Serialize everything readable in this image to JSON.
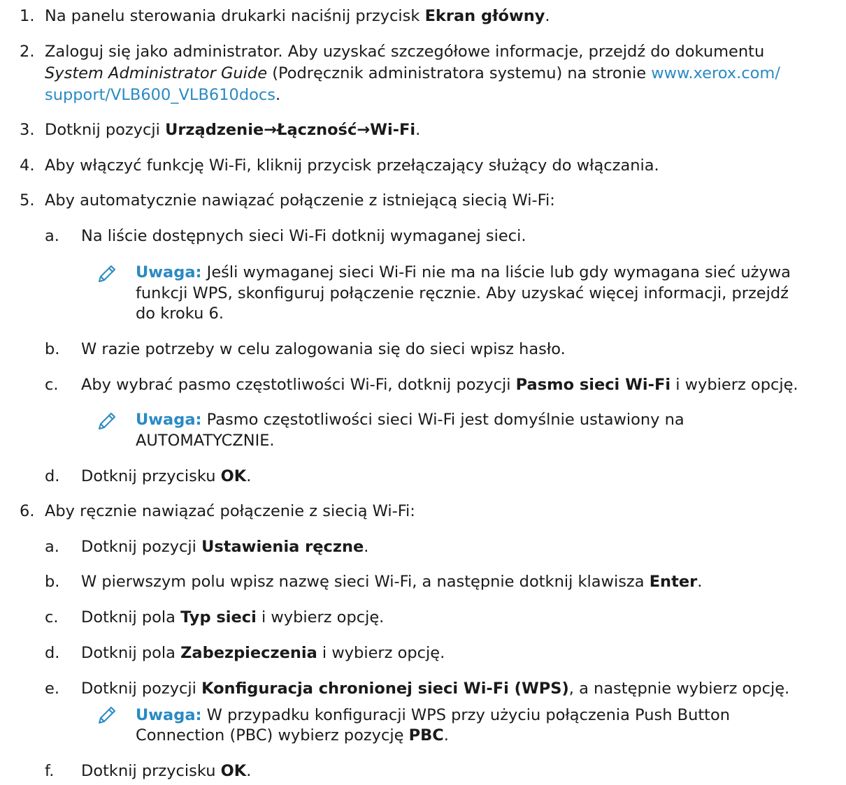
{
  "colors": {
    "text": "#1a1a1a",
    "accent": "#2a8ac4"
  },
  "steps": {
    "s1": {
      "num": "1.",
      "pre": "Na panelu sterowania drukarki naciśnij przycisk ",
      "bold": "Ekran główny",
      "post": "."
    },
    "s2": {
      "num": "2.",
      "line1": "Zaloguj się jako administrator. Aby uzyskać szczegółowe informacje, przejdź do dokumentu",
      "italic": "System Administrator Guide",
      "line2_post": " (Podręcznik administratora systemu) na stronie ",
      "link_part1": "www.xerox.com/",
      "link_part2": "support/VLB600_VLB610docs",
      "line3_post": "."
    },
    "s3": {
      "num": "3.",
      "pre": "Dotknij pozycji ",
      "bold": "Urządzenie→Łączność→Wi-Fi",
      "post": "."
    },
    "s4": {
      "num": "4.",
      "text": "Aby włączyć funkcję Wi-Fi, kliknij przycisk przełączający służący do włączania."
    },
    "s5": {
      "num": "5.",
      "text": "Aby automatycznie nawiązać połączenie z istniejącą siecią Wi-Fi:",
      "a": {
        "letter": "a.",
        "text": "Na liście dostępnych sieci Wi-Fi dotknij wymaganej sieci."
      },
      "note1": {
        "label": "Uwaga:",
        "line1": " Jeśli wymaganej sieci Wi-Fi nie ma na liście lub gdy wymagana sieć używa",
        "line2": "funkcji WPS, skonfiguruj połączenie ręcznie. Aby uzyskać więcej informacji, przejdź",
        "line3": "do kroku 6."
      },
      "b": {
        "letter": "b.",
        "text": "W razie potrzeby w celu zalogowania się do sieci wpisz hasło."
      },
      "c": {
        "letter": "c.",
        "pre": "Aby wybrać pasmo częstotliwości Wi-Fi, dotknij pozycji ",
        "bold": "Pasmo sieci Wi-Fi",
        "post": " i wybierz opcję."
      },
      "note2": {
        "label": "Uwaga:",
        "line1": " Pasmo częstotliwości sieci Wi-Fi jest domyślnie ustawiony na",
        "line2": "AUTOMATYCZNIE."
      },
      "d": {
        "letter": "d.",
        "pre": "Dotknij przycisku ",
        "bold": "OK",
        "post": "."
      }
    },
    "s6": {
      "num": "6.",
      "text": "Aby ręcznie nawiązać połączenie z siecią Wi-Fi:",
      "a": {
        "letter": "a.",
        "pre": "Dotknij pozycji ",
        "bold": "Ustawienia ręczne",
        "post": "."
      },
      "b": {
        "letter": "b.",
        "pre": "W pierwszym polu wpisz nazwę sieci Wi-Fi, a następnie dotknij klawisza ",
        "bold": "Enter",
        "post": "."
      },
      "c": {
        "letter": "c.",
        "pre": "Dotknij pola ",
        "bold": "Typ sieci",
        "post": " i wybierz opcję."
      },
      "d": {
        "letter": "d.",
        "pre": "Dotknij pola ",
        "bold": "Zabezpieczenia",
        "post": " i wybierz opcję."
      },
      "e": {
        "letter": "e.",
        "pre": "Dotknij pozycji ",
        "bold": "Konfiguracja chronionej sieci Wi-Fi (WPS)",
        "post": ", a następnie wybierz opcję."
      },
      "note3": {
        "label": "Uwaga:",
        "line1": " W przypadku konfiguracji WPS przy użyciu połączenia Push Button",
        "line2_pre": "Connection (PBC) wybierz pozycję ",
        "line2_bold": "PBC",
        "line2_post": "."
      },
      "f": {
        "letter": "f.",
        "pre": "Dotknij przycisku ",
        "bold": "OK",
        "post": "."
      }
    }
  }
}
